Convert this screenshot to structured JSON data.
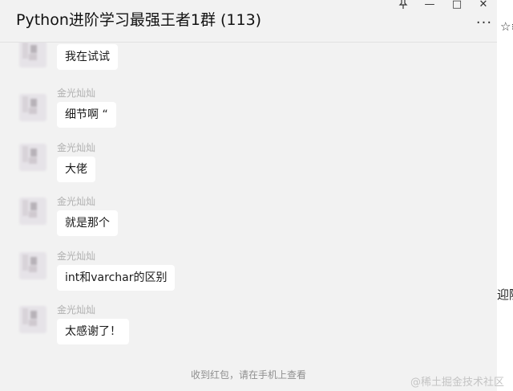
{
  "window": {
    "title": "Python进阶学习最强王者1群 (113)",
    "pin_icon": "pin-icon",
    "minimize_glyph": "—",
    "maximize_glyph": "□",
    "close_glyph": "✕",
    "more_glyph": "···"
  },
  "messages": [
    {
      "sender": "",
      "text": "我在试试"
    },
    {
      "sender": "金光灿灿",
      "text": "细节啊 “"
    },
    {
      "sender": "金光灿灿",
      "text": "大佬"
    },
    {
      "sender": "金光灿灿",
      "text": "就是那个"
    },
    {
      "sender": "金光灿灿",
      "text": "int和varchar的区别"
    },
    {
      "sender": "金光灿灿",
      "text": "太感谢了！"
    }
  ],
  "footer": {
    "notice": "收到红包，请在手机上查看"
  },
  "right_pane": {
    "partial_icon_text": "☆≡",
    "partial_text": "迎随"
  },
  "watermark": "@稀土掘金技术社区",
  "colors": {
    "chat_background": "#f2f2f2",
    "bubble_background": "#ffffff",
    "sender_name": "#b0b0b0"
  }
}
